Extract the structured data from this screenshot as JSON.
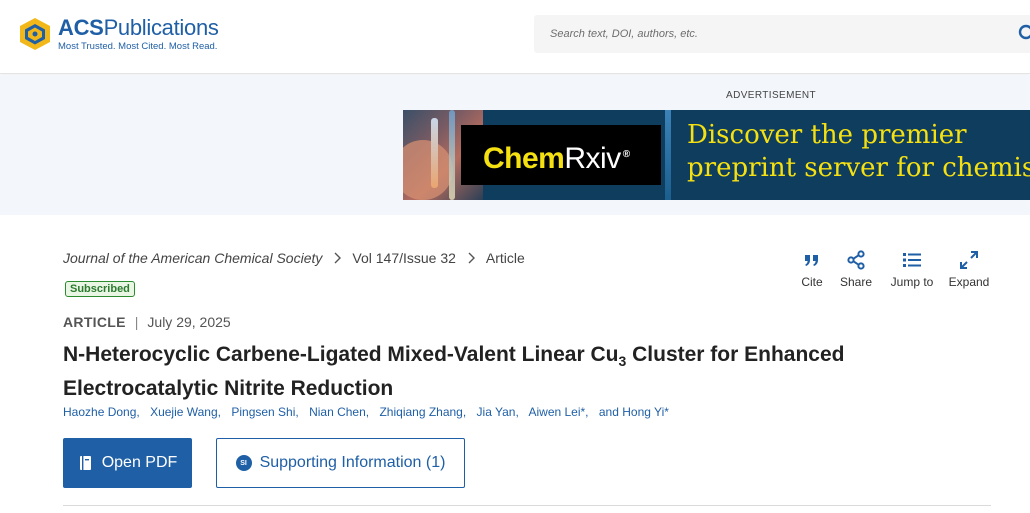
{
  "header": {
    "logo_name_bold": "ACS",
    "logo_name_rest": "Publications",
    "logo_tagline": "Most Trusted. Most Cited. Most Read.",
    "search_placeholder": "Search text, DOI, authors, etc."
  },
  "ad": {
    "label": "ADVERTISEMENT",
    "brand_chem": "Chem",
    "brand_rxiv": "Rxiv",
    "brand_reg": "®",
    "tagline_line1": "Discover the premier",
    "tagline_line2": "preprint server for chemis"
  },
  "breadcrumb": {
    "journal": "Journal of the American Chemical Society",
    "issue": "Vol 147/Issue 32",
    "section": "Article"
  },
  "access_badge": "Subscribed",
  "meta": {
    "type": "ARTICLE",
    "separator": "|",
    "date": "July 29, 2025"
  },
  "title": {
    "part1": "N-Heterocyclic Carbene-Ligated Mixed-Valent Linear Cu",
    "subscript": "3",
    "part2": " Cluster for Enhanced Electrocatalytic Nitrite Reduction"
  },
  "authors": [
    "Haozhe Dong,",
    "Xuejie Wang,",
    "Pingsen Shi,",
    "Nian Chen,",
    "Zhiqiang Zhang,",
    "Jia Yan,",
    "Aiwen Lei*,",
    "and Hong Yi*"
  ],
  "buttons": {
    "open_pdf": "Open PDF",
    "si_badge": "SI",
    "supporting_info": "Supporting Information (1)"
  },
  "tools": {
    "cite": "Cite",
    "share": "Share",
    "jump_to": "Jump to",
    "expand": "Expand"
  },
  "colors": {
    "brand_blue": "#1f5fa6",
    "badge_green": "#2c8a2f",
    "ad_yellow": "#f5e012",
    "ad_navy": "#0e3d5e"
  }
}
